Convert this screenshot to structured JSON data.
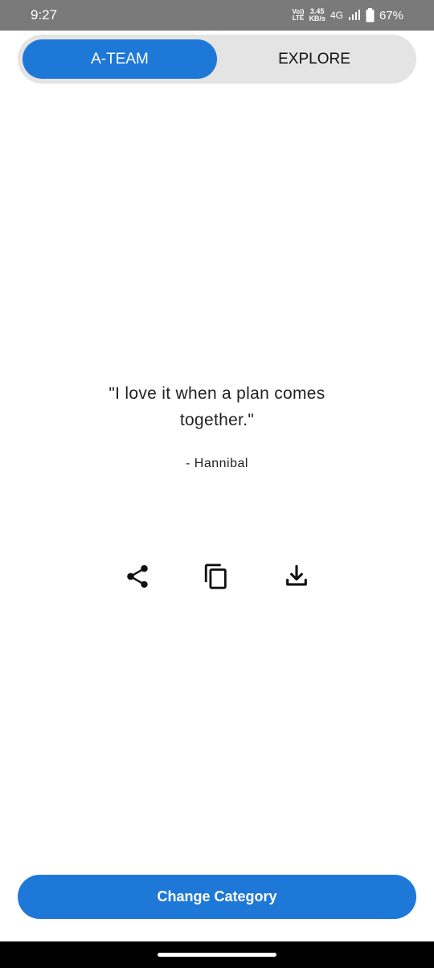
{
  "status_bar": {
    "time": "9:27",
    "volte_top": "Vo))",
    "volte_bottom": "LTE",
    "speed_value": "3.45",
    "speed_unit": "KB/s",
    "network": "4G",
    "battery": "67%"
  },
  "tabs": [
    {
      "label": "A-TEAM",
      "active": true
    },
    {
      "label": "EXPLORE",
      "active": false
    }
  ],
  "quote": {
    "text": "\"I love it when a plan comes together.\"",
    "author": "- Hannibal"
  },
  "actions": [
    "share-icon",
    "copy-icon",
    "download-icon"
  ],
  "cta": {
    "label": "Change Category"
  },
  "colors": {
    "accent": "#1e78d7",
    "toggle_bg": "#e4e4e4",
    "status_bar": "#7a7a7a"
  }
}
